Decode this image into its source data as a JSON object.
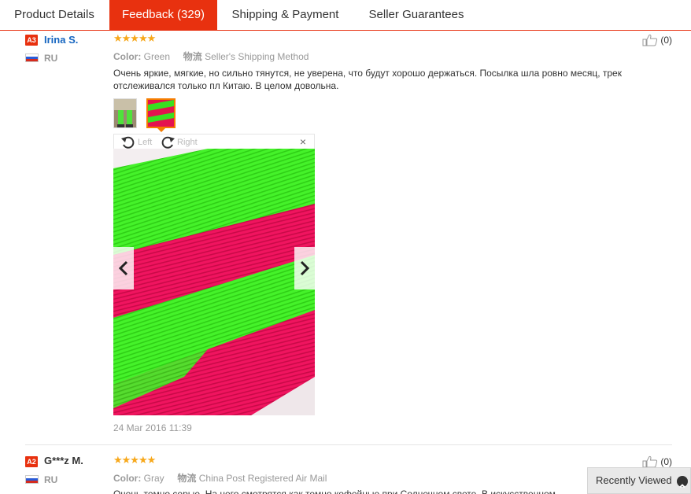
{
  "tabs": [
    {
      "label": "Product Details"
    },
    {
      "label": "Feedback (329)"
    },
    {
      "label": "Shipping & Payment"
    },
    {
      "label": "Seller Guarantees"
    }
  ],
  "colors": {
    "accent": "#e8310f",
    "star": "#f7a81b",
    "link": "#1565c0"
  },
  "reviews": [
    {
      "badge": "A3",
      "name": "Irina S.",
      "country": "RU",
      "stars": "★★★★★",
      "color_label": "Color:",
      "color_value": "Green",
      "logistics_label": "物流",
      "logistics_value": "Seller's Shipping Method",
      "text": "Очень яркие, мягкие, но сильно тянутся, не уверена, что будут хорошо держаться. Посылка шла ровно месяц, трек отслеживался только пл Китаю. В целом довольна.",
      "helpful_count": "(0)",
      "date": "24 Mar 2016 11:39",
      "viewer": {
        "left_label": "Left",
        "right_label": "Right",
        "close": "×"
      }
    },
    {
      "badge": "A2",
      "name": "G***z M.",
      "country": "RU",
      "stars": "★★★★★",
      "color_label": "Color:",
      "color_value": "Gray",
      "logistics_label": "物流",
      "logistics_value": "China Post Registered Air Mail",
      "text": "Очень темно серые. На него смотрятся как темно кофейные при Солнечном свете. В искусственном",
      "helpful_count": "(0)"
    }
  ],
  "recently_viewed": "Recently Viewed"
}
